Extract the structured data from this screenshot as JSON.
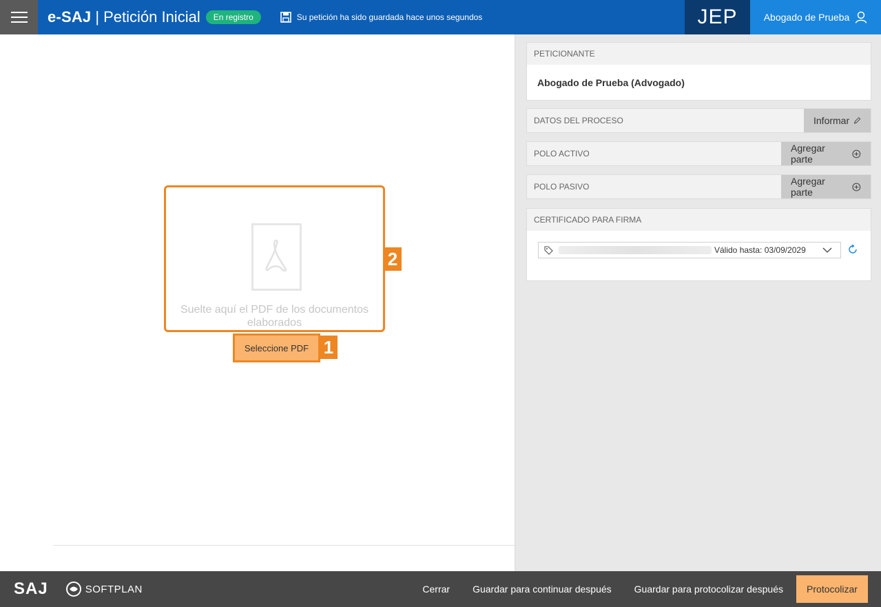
{
  "header": {
    "brand": "e-SAJ",
    "separator": "|",
    "title": "Petición Inicial",
    "status_badge": "En registro",
    "save_status": "Su petición ha sido guardada hace unos segundos",
    "court": "JEP",
    "user_name": "Abogado de Prueba"
  },
  "dropzone": {
    "text": "Suelte aquí el PDF de los documentos elaborados",
    "select_button": "Seleccione PDF",
    "marker_select": "1",
    "marker_dropzone": "2"
  },
  "panel": {
    "peticionante": {
      "label": "PETICIONANTE",
      "name": "Abogado de Prueba (Advogado)"
    },
    "datos_proceso": {
      "label": "DATOS DEL PROCESO",
      "button": "Informar"
    },
    "polo_activo": {
      "label": "POLO ACTIVO",
      "button": "Agregar parte"
    },
    "polo_pasivo": {
      "label": "POLO PASIVO",
      "button": "Agregar parte"
    },
    "certificado": {
      "label": "CERTIFICADO PARA FIRMA",
      "valid_until": "Válido hasta: 03/09/2029"
    }
  },
  "footer": {
    "logo": "SAJ",
    "partner": "SOFTPLAN",
    "actions": {
      "close": "Cerrar",
      "save_continue": "Guardar para continuar después",
      "save_protocol": "Guardar para protocolizar después",
      "protocol": "Protocolizar"
    }
  },
  "colors": {
    "header_blue": "#0d5fb5",
    "court_navy": "#0a3a6e",
    "user_blue": "#1b86dd",
    "badge_green": "#1fb37e",
    "highlight_orange": "#ee8622",
    "button_peach": "#fbb46e",
    "footer_gray": "#474747"
  }
}
